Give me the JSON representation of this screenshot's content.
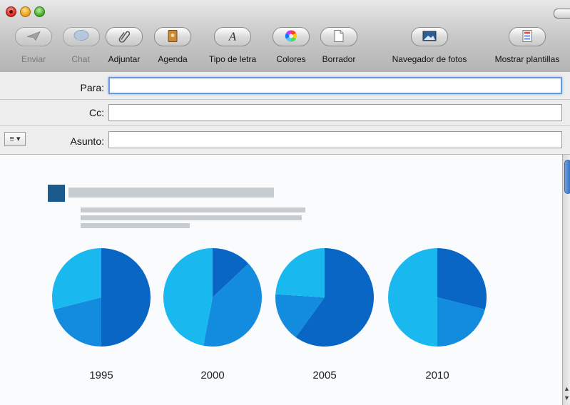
{
  "toolbar": {
    "send_label": "Enviar",
    "chat_label": "Chat",
    "attach_label": "Adjuntar",
    "addressbook_label": "Agenda",
    "fonts_label": "Tipo de letra",
    "colors_label": "Colores",
    "drafts_label": "Borrador",
    "photo_browser_label": "Navegador de fotos",
    "templates_label": "Mostrar plantillas"
  },
  "header": {
    "to_label": "Para:",
    "to_value": "",
    "cc_label": "Cc:",
    "cc_value": "",
    "subject_label": "Asunto:",
    "subject_value": "",
    "list_button_glyph": "≡ ▾"
  },
  "icons": {
    "send": "paper-plane-icon",
    "chat": "speech-bubble-icon",
    "attach": "paperclip-icon",
    "addressbook": "address-book-icon",
    "fonts": "font-a-icon",
    "colors": "color-wheel-icon",
    "drafts": "draft-page-icon",
    "photo_browser": "photo-icon",
    "templates": "template-icon"
  },
  "colors": {
    "pie_dark": "#0a66c4",
    "pie_mid": "#138bde",
    "pie_light": "#19b9f0",
    "banner_square": "#1a5a8e",
    "focus_ring": "#6a9ad8"
  },
  "chart_data": {
    "type": "pie",
    "categories": [
      "1995",
      "2000",
      "2005",
      "2010"
    ],
    "charts": [
      {
        "label": "1995",
        "slices": [
          {
            "value": 50,
            "color": "#0a66c4"
          },
          {
            "value": 21,
            "color": "#138bde"
          },
          {
            "value": 29,
            "color": "#19b9f0"
          }
        ]
      },
      {
        "label": "2000",
        "slices": [
          {
            "value": 13,
            "color": "#0a66c4"
          },
          {
            "value": 40,
            "color": "#138bde"
          },
          {
            "value": 47,
            "color": "#19b9f0"
          }
        ]
      },
      {
        "label": "2005",
        "slices": [
          {
            "value": 60,
            "color": "#0a66c4"
          },
          {
            "value": 16,
            "color": "#138bde"
          },
          {
            "value": 24,
            "color": "#19b9f0"
          }
        ]
      },
      {
        "label": "2010",
        "slices": [
          {
            "value": 29,
            "color": "#0a66c4"
          },
          {
            "value": 21,
            "color": "#138bde"
          },
          {
            "value": 50,
            "color": "#19b9f0"
          }
        ]
      }
    ]
  }
}
